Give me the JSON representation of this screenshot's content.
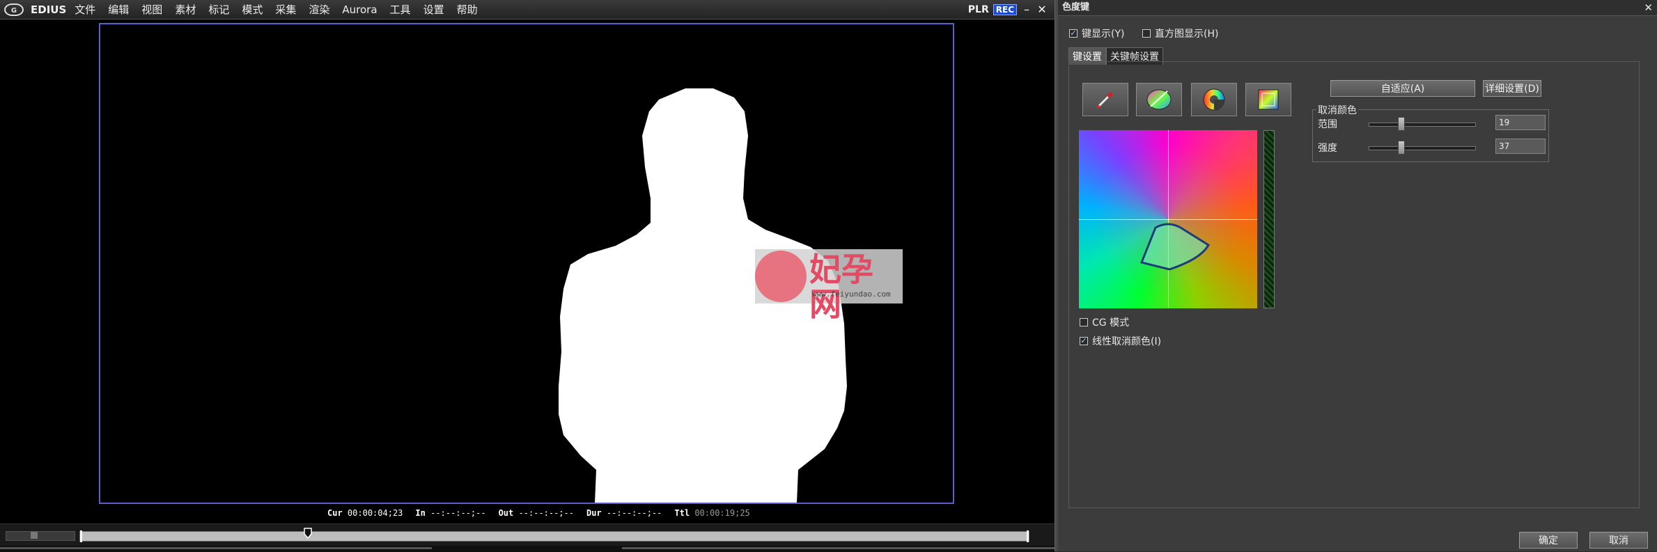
{
  "app": {
    "name": "EDIUS",
    "menu": [
      "文件",
      "编辑",
      "视图",
      "素材",
      "标记",
      "模式",
      "采集",
      "渲染",
      "Aurora",
      "工具",
      "设置",
      "帮助"
    ],
    "plr_label": "PLR",
    "rec_label": "REC"
  },
  "watermark": {
    "text": "妃孕网",
    "url": "www.feiyundao.com"
  },
  "timecodes": [
    {
      "label": "Cur",
      "value": "00:00:04;23",
      "dim": false
    },
    {
      "label": "In",
      "value": "--:--:--;--",
      "dim": false
    },
    {
      "label": "Out",
      "value": "--:--:--;--",
      "dim": false
    },
    {
      "label": "Dur",
      "value": "--:--:--;--",
      "dim": false
    },
    {
      "label": "Ttl",
      "value": "00:00:19;25",
      "dim": true
    }
  ],
  "dialog": {
    "title": "色度键",
    "key_display": {
      "label": "键显示(Y)",
      "checked": true
    },
    "histogram": {
      "label": "直方图显示(H)",
      "checked": false
    },
    "tabs": [
      "键设置",
      "关键帧设置"
    ],
    "active_tab": 0,
    "tools": [
      "eyedropper-icon",
      "color-region-icon",
      "hue-wheel-icon",
      "color-square-icon"
    ],
    "auto_button": "自适应(A)",
    "detail_button": "详细设置(D)",
    "cancel_color_group": "取消颜色",
    "range": {
      "label": "范围",
      "value": "19"
    },
    "strength": {
      "label": "强度",
      "value": "37"
    },
    "cg_mode": {
      "label": "CG 模式",
      "checked": false
    },
    "linear_cancel": {
      "label": "线性取消颜色(I)",
      "checked": true
    },
    "ok_button": "确定",
    "cancel_button": "取消",
    "accent": "#5a5fd0"
  }
}
